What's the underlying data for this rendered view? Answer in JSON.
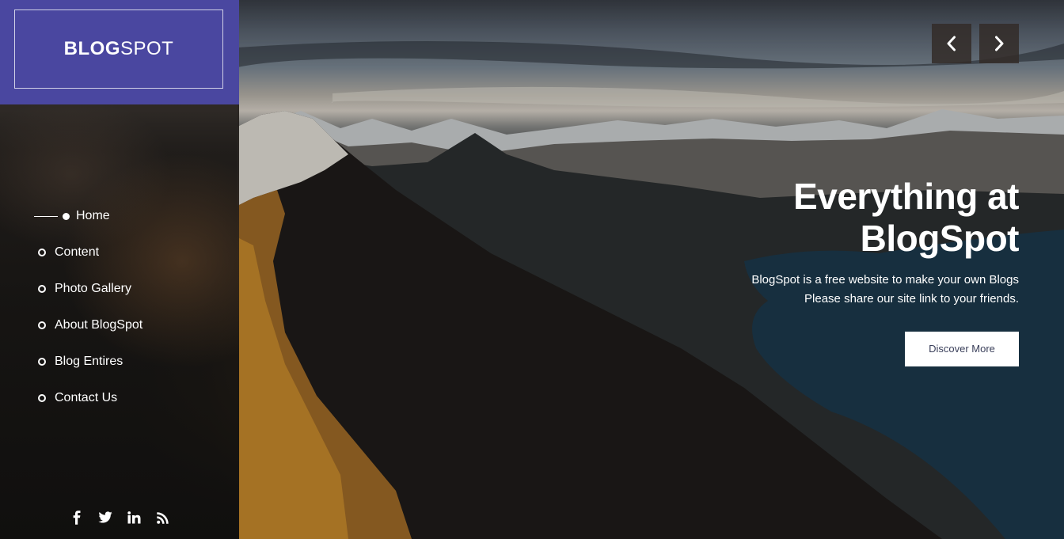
{
  "brand": {
    "bold_part": "BLOG",
    "light_part": "SPOT",
    "bar_color": "#4a47a0"
  },
  "nav": {
    "items": [
      {
        "label": "Home",
        "active": true
      },
      {
        "label": "Content",
        "active": false
      },
      {
        "label": "Photo Gallery",
        "active": false
      },
      {
        "label": "About BlogSpot",
        "active": false
      },
      {
        "label": "Blog Entires",
        "active": false
      },
      {
        "label": "Contact Us",
        "active": false
      }
    ]
  },
  "social": {
    "icons": [
      "facebook-icon",
      "twitter-icon",
      "linkedin-icon",
      "rss-icon"
    ]
  },
  "slider": {
    "prev_icon": "chevron-left-icon",
    "next_icon": "chevron-right-icon"
  },
  "hero": {
    "title_line1": "Everything at",
    "title_line2": "BlogSpot",
    "desc_line1": "BlogSpot is a free website to make your own Blogs",
    "desc_line2": "Please share our site link to your friends.",
    "button_label": "Discover More"
  }
}
